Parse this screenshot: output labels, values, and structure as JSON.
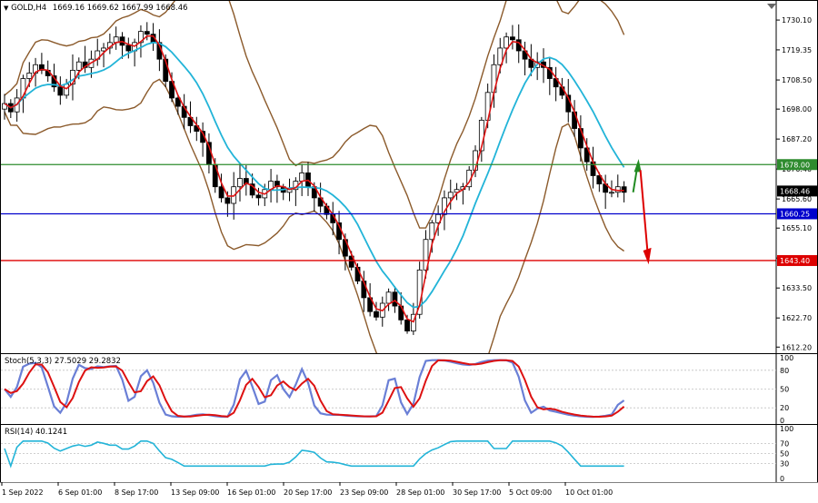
{
  "header": {
    "symbol_label": "GOLD,H4",
    "ohlc": "1669.16 1669.62 1667.99 1668.46"
  },
  "price_axis": {
    "ticks": [
      "1730.10",
      "1719.35",
      "1708.50",
      "1698.00",
      "1687.20",
      "1676.40",
      "1665.60",
      "1655.10",
      "1644.30",
      "1633.50",
      "1622.70",
      "1612.20"
    ],
    "current_price": "1668.46"
  },
  "levels": [
    {
      "label": "1678.00",
      "price": 1678.0,
      "color": "#2e8b2e"
    },
    {
      "label": "1660.25",
      "price": 1660.25,
      "color": "#0000cc"
    },
    {
      "label": "1643.40",
      "price": 1643.4,
      "color": "#dd0000"
    }
  ],
  "stoch": {
    "label": "Stoch(5,3,3) 27.5029 29.2832",
    "ticks": [
      "100",
      "80",
      "50",
      "20",
      "0"
    ],
    "main_color": "#6a7fd6",
    "signal_color": "#dd1111"
  },
  "rsi": {
    "label": "RSI(14) 40.1241",
    "ticks": [
      "100",
      "70",
      "50",
      "30",
      "0"
    ],
    "line_color": "#22b4d8"
  },
  "time_axis": {
    "labels": [
      "1 Sep 2022",
      "6 Sep 01:00",
      "8 Sep 17:00",
      "13 Sep 09:00",
      "16 Sep 01:00",
      "20 Sep 17:00",
      "23 Sep 09:00",
      "28 Sep 01:00",
      "30 Sep 17:00",
      "5 Oct 09:00",
      "10 Oct 01:00"
    ]
  },
  "colors": {
    "bollinger": "#8b5a2b",
    "ma_fast": "#dd1111",
    "ma_slow": "#22b4d8",
    "candles": "#000000",
    "arrow_up": "#228b22",
    "arrow_down": "#dd0000"
  },
  "chart_data": {
    "type": "candlestick",
    "symbol": "GOLD",
    "timeframe": "H4",
    "ylim": [
      1610,
      1737
    ],
    "close_series": [
      1700,
      1697,
      1702,
      1709,
      1711,
      1714,
      1712,
      1710,
      1706,
      1703,
      1707,
      1712,
      1715,
      1713,
      1716,
      1719,
      1720,
      1722,
      1724,
      1721,
      1719,
      1722,
      1726,
      1725,
      1722,
      1716,
      1708,
      1702,
      1699,
      1695,
      1692,
      1690,
      1686,
      1678,
      1670,
      1666,
      1664,
      1670,
      1673,
      1671,
      1667,
      1666,
      1669,
      1672,
      1670,
      1668,
      1669,
      1672,
      1675,
      1670,
      1666,
      1663,
      1660,
      1657,
      1651,
      1645,
      1641,
      1636,
      1630,
      1625,
      1623,
      1628,
      1632,
      1627,
      1622,
      1618,
      1624,
      1640,
      1651,
      1657,
      1660,
      1666,
      1668,
      1669,
      1670,
      1676,
      1683,
      1694,
      1704,
      1714,
      1720,
      1724,
      1723,
      1719,
      1716,
      1713,
      1715,
      1713,
      1709,
      1706,
      1703,
      1697,
      1691,
      1684,
      1679,
      1674,
      1671,
      1668,
      1668,
      1670,
      1668
    ]
  }
}
